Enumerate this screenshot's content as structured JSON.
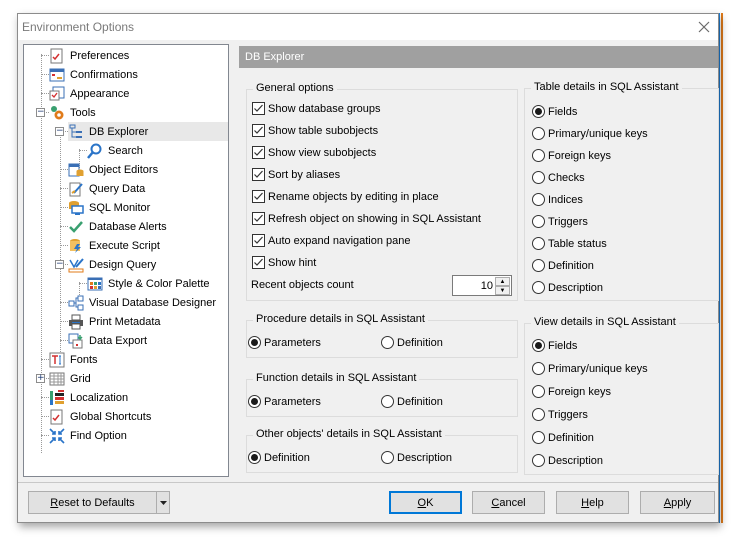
{
  "window": {
    "title": "Environment Options",
    "close_label": "×"
  },
  "tree": {
    "items": [
      {
        "label": "Preferences",
        "icon": "preferences-icon"
      },
      {
        "label": "Confirmations",
        "icon": "confirmations-icon"
      },
      {
        "label": "Appearance",
        "icon": "appearance-icon"
      },
      {
        "label": "Tools",
        "icon": "tools-icon",
        "expanded": true
      },
      {
        "label": "DB Explorer",
        "icon": "db-explorer-icon",
        "expanded": true,
        "selected": true
      },
      {
        "label": "Search",
        "icon": "search-icon"
      },
      {
        "label": "Object Editors",
        "icon": "object-editors-icon"
      },
      {
        "label": "Query Data",
        "icon": "query-data-icon"
      },
      {
        "label": "SQL Monitor",
        "icon": "sql-monitor-icon"
      },
      {
        "label": "Database Alerts",
        "icon": "checkmark-icon"
      },
      {
        "label": "Execute Script",
        "icon": "execute-script-icon"
      },
      {
        "label": "Design Query",
        "icon": "design-query-icon",
        "expanded": true
      },
      {
        "label": "Style & Color Palette",
        "icon": "palette-icon"
      },
      {
        "label": "Visual Database Designer",
        "icon": "designer-icon"
      },
      {
        "label": "Print Metadata",
        "icon": "printer-icon"
      },
      {
        "label": "Data Export",
        "icon": "data-export-icon"
      },
      {
        "label": "Fonts",
        "icon": "fonts-icon"
      },
      {
        "label": "Grid",
        "icon": "grid-icon",
        "expanded": false
      },
      {
        "label": "Localization",
        "icon": "localization-icon"
      },
      {
        "label": "Global Shortcuts",
        "icon": "shortcuts-icon"
      },
      {
        "label": "Find Option",
        "icon": "find-option-icon"
      }
    ]
  },
  "panel": {
    "header": "DB Explorer",
    "general": {
      "title": "General options",
      "checkboxes": [
        {
          "label": "Show database groups",
          "checked": true
        },
        {
          "label": "Show table subobjects",
          "checked": true
        },
        {
          "label": "Show view subobjects",
          "checked": true
        },
        {
          "label": "Sort by aliases",
          "checked": true
        },
        {
          "label": "Rename objects by editing in place",
          "checked": true
        },
        {
          "label": "Refresh object on showing in SQL Assistant",
          "checked": true
        },
        {
          "label": "Auto expand navigation pane",
          "checked": true
        },
        {
          "label": "Show hint",
          "checked": true
        }
      ],
      "recent_label": "Recent objects count",
      "recent_value": "10"
    },
    "procedure": {
      "title": "Procedure details in SQL Assistant",
      "options": [
        {
          "label": "Parameters",
          "selected": true
        },
        {
          "label": "Definition",
          "selected": false
        }
      ]
    },
    "function": {
      "title": "Function details in SQL Assistant",
      "options": [
        {
          "label": "Parameters",
          "selected": true
        },
        {
          "label": "Definition",
          "selected": false
        }
      ]
    },
    "other": {
      "title": "Other objects' details in SQL Assistant",
      "options": [
        {
          "label": "Definition",
          "selected": true
        },
        {
          "label": "Description",
          "selected": false
        }
      ]
    },
    "table": {
      "title": "Table details in SQL Assistant",
      "options": [
        {
          "label": "Fields",
          "selected": true
        },
        {
          "label": "Primary/unique keys",
          "selected": false
        },
        {
          "label": "Foreign keys",
          "selected": false
        },
        {
          "label": "Checks",
          "selected": false
        },
        {
          "label": "Indices",
          "selected": false
        },
        {
          "label": "Triggers",
          "selected": false
        },
        {
          "label": "Table status",
          "selected": false
        },
        {
          "label": "Definition",
          "selected": false
        },
        {
          "label": "Description",
          "selected": false
        }
      ]
    },
    "view": {
      "title": "View details in SQL Assistant",
      "options": [
        {
          "label": "Fields",
          "selected": true
        },
        {
          "label": "Primary/unique keys",
          "selected": false
        },
        {
          "label": "Foreign keys",
          "selected": false
        },
        {
          "label": "Triggers",
          "selected": false
        },
        {
          "label": "Definition",
          "selected": false
        },
        {
          "label": "Description",
          "selected": false
        }
      ]
    }
  },
  "footer": {
    "reset": {
      "accel": "R",
      "rest": "eset to Defaults"
    },
    "ok": {
      "accel": "O",
      "rest": "K"
    },
    "cancel": {
      "accel": "C",
      "rest": "ancel"
    },
    "help": {
      "accel": "H",
      "rest": "elp"
    },
    "apply": {
      "accel": "A",
      "rest": "pply"
    }
  }
}
